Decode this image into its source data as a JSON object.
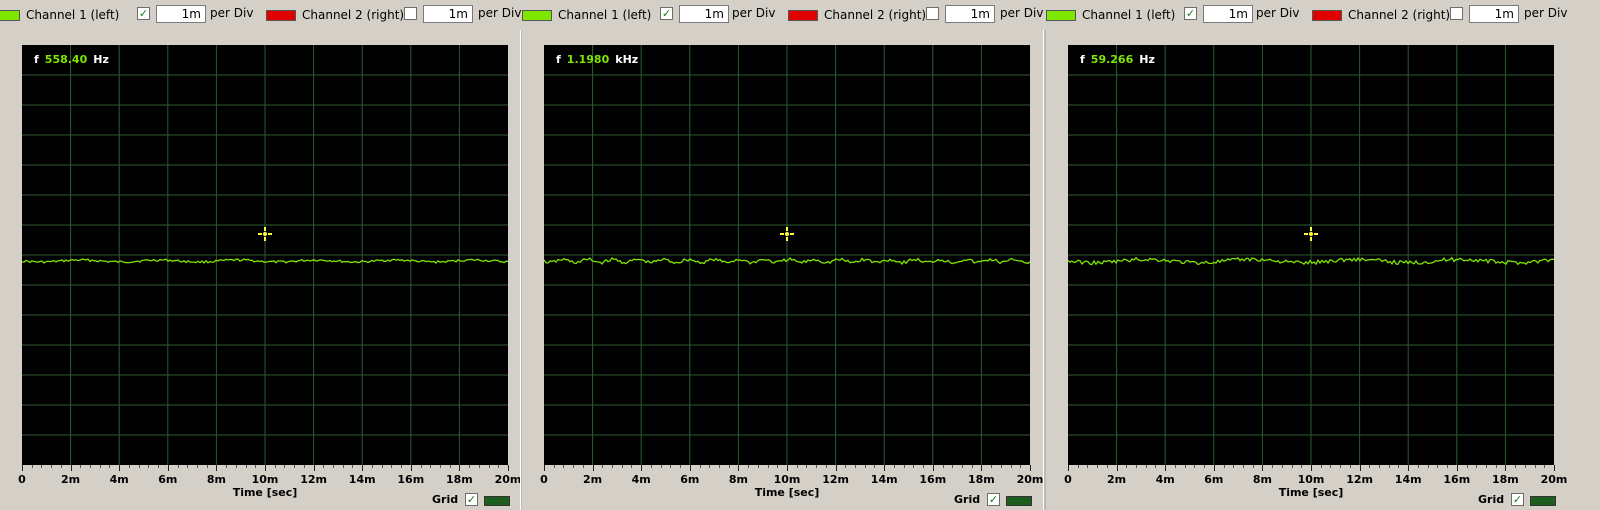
{
  "colors": {
    "channel1": "#7fe600",
    "channel2": "#e00000",
    "grid": "#2f5a2f",
    "plot_bg": "#000000",
    "marker": "#ffff33",
    "grid_swatch": "#1d5d1d"
  },
  "icons": {
    "check": "✓",
    "marker": "crosshair-marker-icon"
  },
  "panels": [
    {
      "channel1": {
        "label": "Channel 1 (left)",
        "enabled": true,
        "value": "1m",
        "per_div": "per Div"
      },
      "channel2": {
        "label": "Channel 2 (right)",
        "enabled": false,
        "value": "1m",
        "per_div": "per Div"
      },
      "freq": {
        "label": "f",
        "value": "558.40",
        "unit": "Hz"
      },
      "x_axis": {
        "title": "Time [sec]",
        "ticks": [
          "0",
          "2m",
          "4m",
          "6m",
          "8m",
          "10m",
          "12m",
          "14m",
          "16m",
          "18m",
          "20m"
        ]
      },
      "grid": {
        "label": "Grid",
        "enabled": true
      }
    },
    {
      "channel1": {
        "label": "Channel 1 (left)",
        "enabled": true,
        "value": "1m",
        "per_div": "per Div"
      },
      "channel2": {
        "label": "Channel 2 (right)",
        "enabled": false,
        "value": "1m",
        "per_div": "per Div"
      },
      "freq": {
        "label": "f",
        "value": "1.1980",
        "unit": "kHz"
      },
      "x_axis": {
        "title": "Time [sec]",
        "ticks": [
          "0",
          "2m",
          "4m",
          "6m",
          "8m",
          "10m",
          "12m",
          "14m",
          "16m",
          "18m",
          "20m"
        ]
      },
      "grid": {
        "label": "Grid",
        "enabled": true
      }
    },
    {
      "channel1": {
        "label": "Channel 1 (left)",
        "enabled": true,
        "value": "1m",
        "per_div": "per Div"
      },
      "channel2": {
        "label": "Channel 2 (right)",
        "enabled": false,
        "value": "1m",
        "per_div": "per Div"
      },
      "freq": {
        "label": "f",
        "value": "59.266",
        "unit": "Hz"
      },
      "x_axis": {
        "title": "Time [sec]",
        "ticks": [
          "0",
          "2m",
          "4m",
          "6m",
          "8m",
          "10m",
          "12m",
          "14m",
          "16m",
          "18m",
          "20m"
        ]
      },
      "grid": {
        "label": "Grid",
        "enabled": true
      }
    }
  ]
}
